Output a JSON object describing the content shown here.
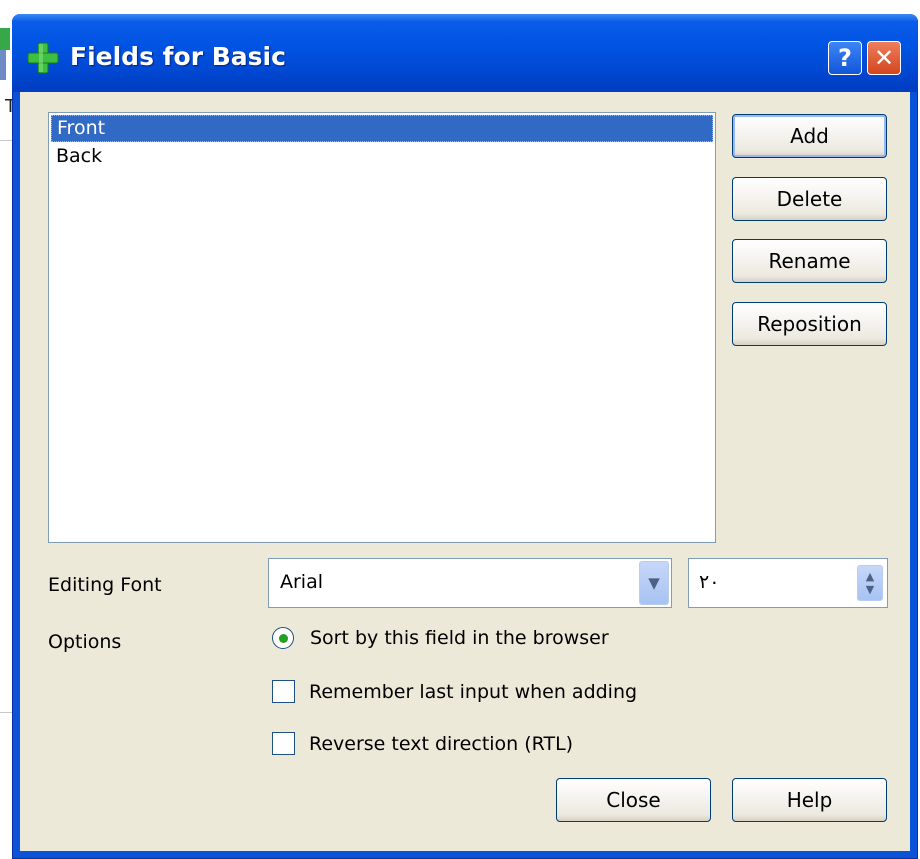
{
  "window": {
    "title": "Fields for Basic",
    "help_glyph": "?",
    "close_glyph": "✕"
  },
  "background": {
    "stray_char": "T"
  },
  "fields_list": {
    "items": [
      {
        "label": "Front",
        "selected": true
      },
      {
        "label": "Back",
        "selected": false
      }
    ]
  },
  "side_buttons": {
    "add": "Add",
    "delete": "Delete",
    "rename": "Rename",
    "reposition": "Reposition"
  },
  "editing_font": {
    "label": "Editing Font",
    "font_value": "Arial",
    "size_value": "٢٠"
  },
  "options": {
    "label": "Options",
    "sort_by_field": {
      "label": "Sort by this field in the browser",
      "checked": true
    },
    "remember_last_input": {
      "label": "Remember last input when adding",
      "checked": false
    },
    "reverse_text_direction": {
      "label": "Reverse text direction (RTL)",
      "checked": false
    }
  },
  "footer": {
    "close": "Close",
    "help": "Help"
  },
  "colors": {
    "titlebar": "#0054e3",
    "selection": "#316ac5",
    "dialog_bg": "#ece9d8",
    "radio_dot": "#21a121"
  }
}
